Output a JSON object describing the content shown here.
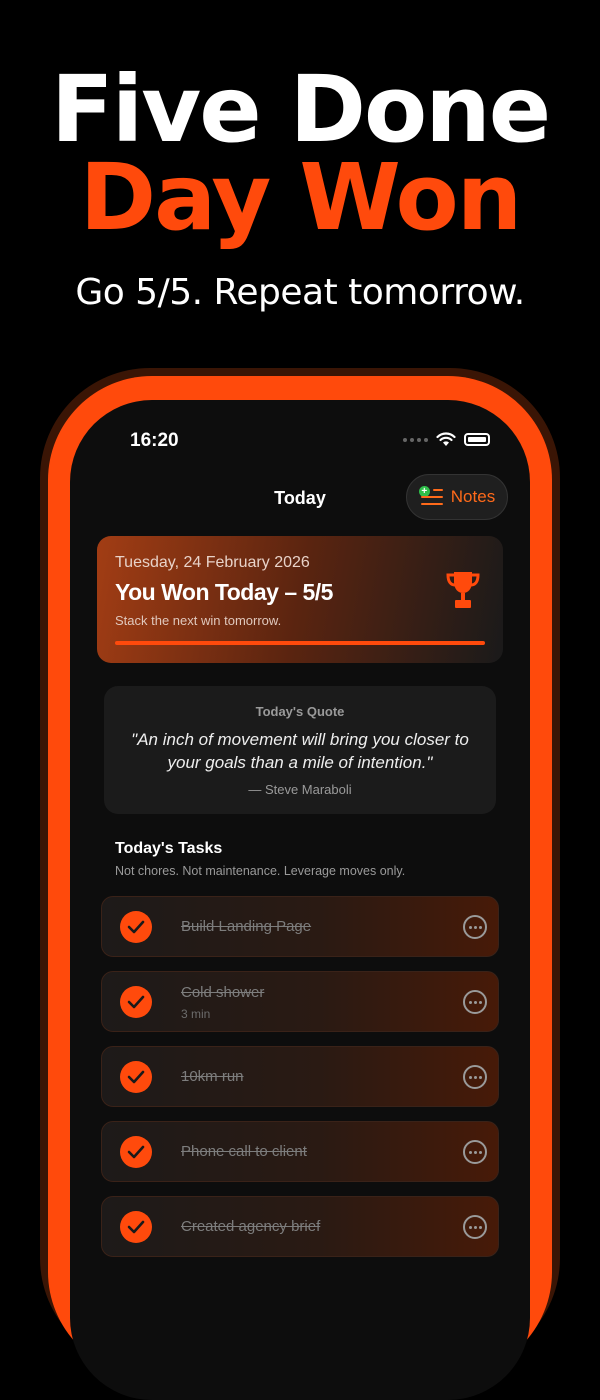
{
  "promo": {
    "headline_line1": "Five Done",
    "headline_line2": "Day Won",
    "tagline": "Go 5/5. Repeat tomorrow.",
    "accent_color": "#ff4a0c"
  },
  "status_bar": {
    "time": "16:20"
  },
  "nav": {
    "title": "Today",
    "notes_label": "Notes"
  },
  "win_card": {
    "date": "Tuesday, 24 February 2026",
    "title": "You Won Today – 5/5",
    "subtitle": "Stack the next win tomorrow.",
    "icon": "trophy-icon",
    "progress": 1.0
  },
  "quote": {
    "label": "Today's Quote",
    "text": "\"An inch of movement will bring you closer to your goals than a mile of intention.\"",
    "author": "— Steve Maraboli"
  },
  "tasks": {
    "title": "Today's Tasks",
    "subtitle": "Not chores. Not maintenance. Leverage moves only.",
    "items": [
      {
        "name": "Build Landing Page",
        "meta": "",
        "done": true
      },
      {
        "name": "Cold shower",
        "meta": "3 min",
        "done": true
      },
      {
        "name": "10km run",
        "meta": "",
        "done": true
      },
      {
        "name": "Phone call to client",
        "meta": "",
        "done": true
      },
      {
        "name": "Created agency brief",
        "meta": "",
        "done": true
      }
    ]
  }
}
